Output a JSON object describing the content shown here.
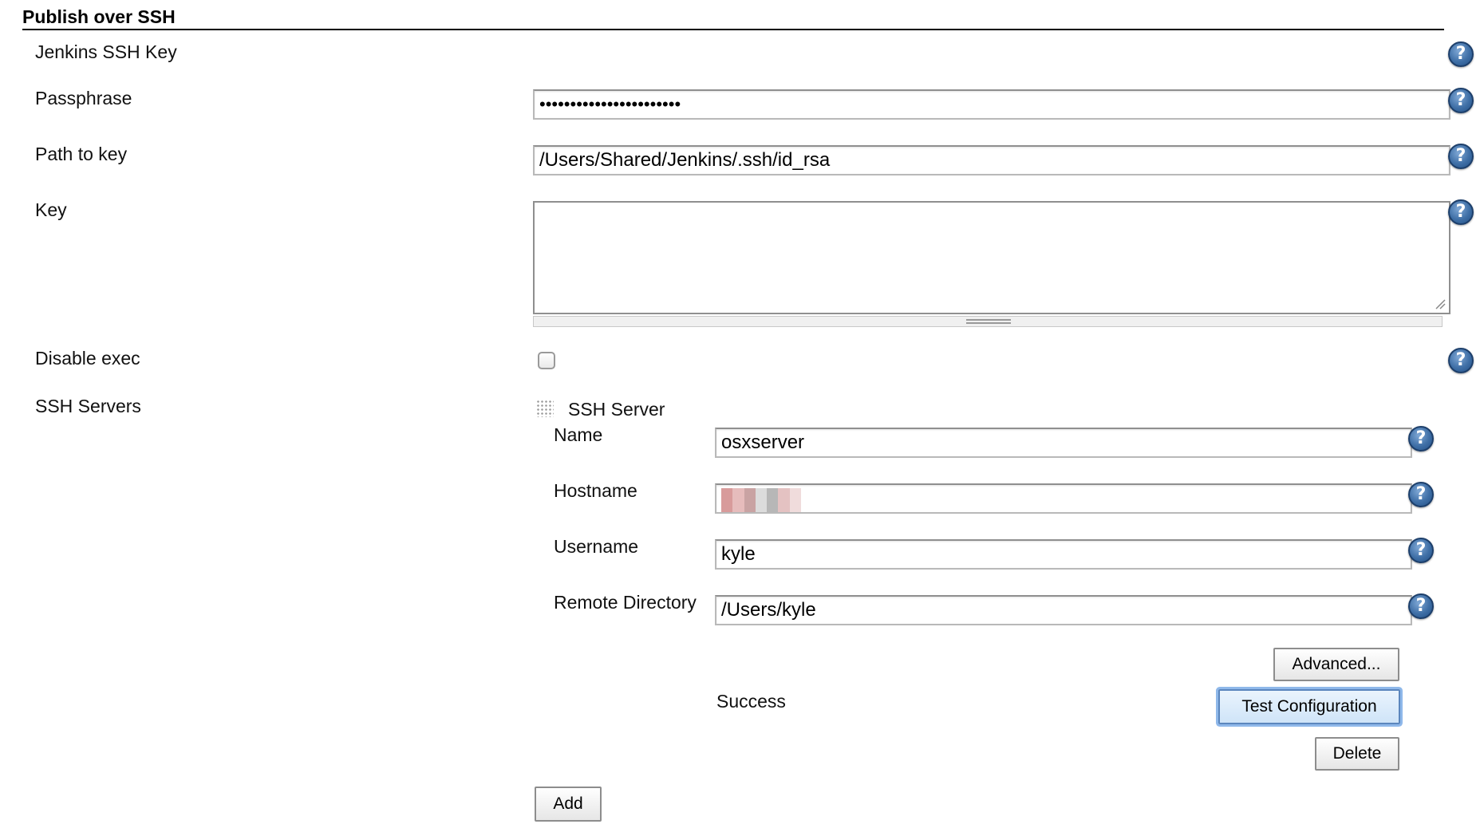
{
  "section": {
    "title": "Publish over SSH"
  },
  "fields": {
    "jenkins_ssh_key_label": "Jenkins SSH Key",
    "passphrase_label": "Passphrase",
    "passphrase_value": "•••••••••••••••••••••••",
    "path_to_key_label": "Path to key",
    "path_to_key_value": "/Users/Shared/Jenkins/.ssh/id_rsa",
    "key_label": "Key",
    "key_value": "",
    "disable_exec_label": "Disable exec",
    "disable_exec_checked": false,
    "ssh_servers_label": "SSH Servers"
  },
  "ssh_server": {
    "heading": "SSH Server",
    "name_label": "Name",
    "name_value": "osxserver",
    "hostname_label": "Hostname",
    "hostname_value": "",
    "username_label": "Username",
    "username_value": "kyle",
    "remote_directory_label": "Remote Directory",
    "remote_directory_value": "/Users/kyle",
    "status_text": "Success",
    "advanced_button": "Advanced...",
    "test_button": "Test Configuration",
    "delete_button": "Delete"
  },
  "actions": {
    "add_button": "Add"
  },
  "icons": {
    "help": "help-question-icon",
    "drag": "drag-handle-icon"
  },
  "help_glyph": "?",
  "colors": {
    "help_icon": "#3f6fa6",
    "focus_ring": "#8fb8ea"
  }
}
